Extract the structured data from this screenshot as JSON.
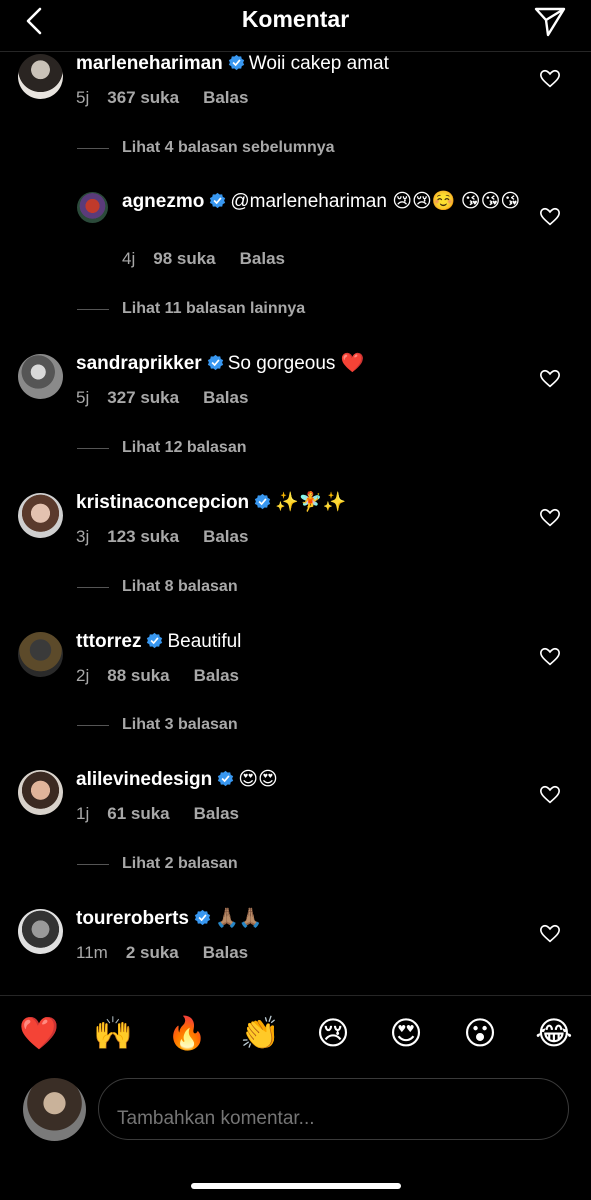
{
  "header": {
    "title": "Komentar"
  },
  "comments": [
    {
      "username": "marlenehariman",
      "text": "Woii cakep amat",
      "time": "5j",
      "likes": "367 suka",
      "reply": "Balas"
    },
    {
      "username": "agnezmo",
      "text": "@marlenehariman 😢😢☺️ 😘😘😘",
      "time": "4j",
      "likes": "98 suka",
      "reply": "Balas"
    },
    {
      "username": "sandraprikker",
      "text": "So gorgeous ❤️",
      "time": "5j",
      "likes": "327 suka",
      "reply": "Balas"
    },
    {
      "username": "kristinaconcepcion",
      "text": "✨🧚✨",
      "time": "3j",
      "likes": "123 suka",
      "reply": "Balas"
    },
    {
      "username": "tttorrez",
      "text": "Beautiful",
      "time": "2j",
      "likes": "88 suka",
      "reply": "Balas"
    },
    {
      "username": "alilevinedesign",
      "text": "😍😍",
      "time": "1j",
      "likes": "61 suka",
      "reply": "Balas"
    },
    {
      "username": "toureroberts",
      "text": "🙏🏽🙏🏽",
      "time": "11m",
      "likes": "2 suka",
      "reply": "Balas"
    }
  ],
  "view_replies": [
    "Lihat 4 balasan sebelumnya",
    "Lihat 11 balasan lainnya",
    "Lihat 12 balasan",
    "Lihat 8 balasan",
    "Lihat 3 balasan",
    "Lihat 2 balasan"
  ],
  "emoji_bar": [
    "❤️",
    "🙌",
    "🔥",
    "👏",
    "😢",
    "😍",
    "😮",
    "😂"
  ],
  "composer": {
    "placeholder": "Tambahkan komentar..."
  },
  "colors": {
    "background": "#000000",
    "verified": "#3897f0",
    "secondary_text": "#a8a8a8"
  }
}
